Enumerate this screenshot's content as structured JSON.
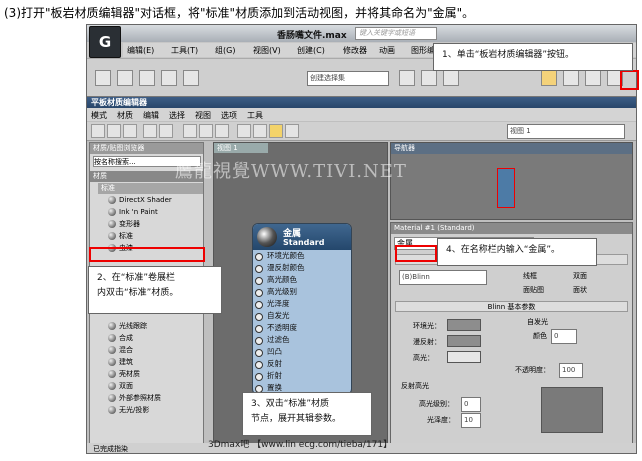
{
  "instruction": "(3)打开\"板岩材质编辑器\"对话框，将\"标准\"材质添加到活动视图，并将其命名为\"金属\"。",
  "app": {
    "logo": "G",
    "title": "香肠嘴文件.max",
    "search_placeholder": "键入关键字或短语"
  },
  "main_menu": [
    "编辑(E)",
    "工具(T)",
    "组(G)",
    "视图(V)",
    "创建(C)",
    "修改器",
    "动画",
    "图形编辑器"
  ],
  "toolbar": {
    "selection_set": "创建选择集"
  },
  "sme": {
    "title": "平板材质编辑器",
    "menu": [
      "模式",
      "材质",
      "编辑",
      "选择",
      "视图",
      "选项",
      "工具"
    ],
    "view_select": "视图 1",
    "browser": {
      "header": "材质/贴图浏览器",
      "search": "按名称搜索...",
      "group": "材质",
      "subgroup": "标准",
      "items": [
        "DirectX Shader",
        "Ink 'n Paint",
        "变形器",
        "标准",
        "虫漆",
        "光线跟踪",
        "合成",
        "混合",
        "建筑",
        "壳材质",
        "双面",
        "外部参照材质",
        "无光/投影"
      ]
    },
    "view_tab": "视图 1",
    "node": {
      "name": "金属",
      "type": "Standard",
      "slots": [
        "环境光颜色",
        "漫反射颜色",
        "高光颜色",
        "高光级别",
        "光泽度",
        "自发光",
        "不透明度",
        "过滤色",
        "凹凸",
        "反射",
        "折射",
        "置换"
      ]
    },
    "navigator": "导航器",
    "params": {
      "header": "Material #1 (Standard)",
      "name_value": "金属",
      "rollout_basic": "明暗器基本参数",
      "shader": "(B)Blinn",
      "checks": [
        "线框",
        "双面",
        "面贴图",
        "面状"
      ],
      "rollout_blinn": "Blinn 基本参数",
      "selfillum": "自发光",
      "color_label": "颜色",
      "color_value": "0",
      "ambient": "环境光：",
      "diffuse": "漫反射：",
      "specular": "高光：",
      "opacity_label": "不透明度：",
      "opacity_value": "100",
      "reflect_hl": "反射高光",
      "spec_level": "高光级别：",
      "spec_level_value": "0",
      "gloss": "光泽度：",
      "gloss_value": "10"
    },
    "status": "已完成指染"
  },
  "callouts": {
    "c1": "1、单击“板岩材质编辑器”按钮。",
    "c2a": "2、在“标准”卷展栏",
    "c2b": "内双击“标准”材质。",
    "c3a": "3、双击“标准”材质",
    "c3b": "节点，展开其辑参数。",
    "c4": "4、在名称栏内输入“金属”。"
  },
  "watermark": "鷹龍視覺WWW.TIVI.NET",
  "credit": "3Dmax吧 【www.lin ecg.com/tieba/171】",
  "colors": {
    "accent": "#2a4a70",
    "highlight": "#ee0000"
  }
}
